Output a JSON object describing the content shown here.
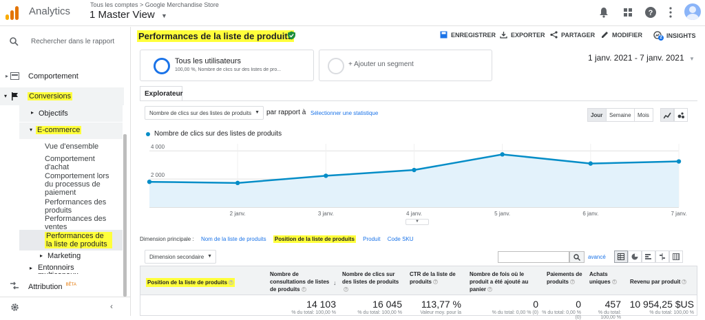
{
  "app": {
    "name": "Analytics",
    "breadcrumb": "Tous les comptes > Google Merchandise Store",
    "view": "1 Master View"
  },
  "sidebar": {
    "search_placeholder": "Rechercher dans le rapport",
    "items": [
      {
        "label": "Comportement"
      },
      {
        "label": "Conversions"
      },
      {
        "label": "Objectifs"
      },
      {
        "label": "E-commerce"
      }
    ],
    "ecommerce_children": [
      "Vue d'ensemble",
      "Comportement d'achat",
      "Comportement lors du processus de paiement",
      "Performances des produits",
      "Performances des ventes",
      "Performances de la liste de produits"
    ],
    "marketing": "Marketing",
    "funnels": "Entonnoirs multicanaux",
    "attribution": "Attribution",
    "attribution_badge": "BÊTA"
  },
  "report": {
    "title": "Performances de la liste de produits",
    "actions": [
      "ENREGISTRER",
      "EXPORTER",
      "PARTAGER",
      "MODIFIER",
      "INSIGHTS"
    ],
    "insights_badge": "2",
    "segment_all": "Tous les utilisateurs",
    "segment_all_sub": "100,00 %, Nombre de clics sur des listes de pro...",
    "segment_add": "+ Ajouter un segment",
    "date_range": "1 janv. 2021 - 7 janv. 2021",
    "tab": "Explorateur",
    "metric_dropdown": "Nombre de clics sur des listes de produits",
    "compare_label": "par rapport à",
    "compare_link": "Sélectionner une statistique",
    "granularity": [
      "Jour",
      "Semaine",
      "Mois"
    ],
    "legend": "Nombre de clics sur des listes de produits",
    "primary_dim_label": "Dimension principale :",
    "primary_dims": [
      "Nom de la liste de produits",
      "Position de la liste de produits",
      "Produit",
      "Code SKU"
    ],
    "secondary_dim": "Dimension secondaire",
    "advanced": "avancé"
  },
  "chart_data": {
    "type": "line",
    "x": [
      "1 janv.",
      "2 janv.",
      "3 janv.",
      "4 janv.",
      "5 janv.",
      "6 janv.",
      "7 janv."
    ],
    "tick_labels": [
      "2 janv.",
      "3 janv.",
      "4 janv.",
      "5 janv.",
      "6 janv.",
      "7 janv."
    ],
    "series": [
      {
        "name": "Nombre de clics sur des listes de produits",
        "values": [
          1800,
          1720,
          2230,
          2640,
          3750,
          3100,
          3250
        ]
      }
    ],
    "yticks": [
      "2 000",
      "4 000"
    ],
    "ylim": [
      0,
      4500
    ],
    "color": "#058dc7",
    "grid": true
  },
  "table": {
    "headers": [
      "Position de la liste de produits",
      "Nombre de consultations de listes de produits",
      "Nombre de clics sur des listes de produits",
      "CTR de la liste de produits",
      "Nombre de fois où le produit a été ajouté au panier",
      "Paiements de produits",
      "Achats uniques",
      "Revenu par produit"
    ],
    "totals": [
      "14 103",
      "16 045",
      "113,77 %",
      "0",
      "0",
      "457",
      "10 954,25 $US"
    ],
    "totals_sub": [
      "% du total: 100,00 %",
      "% du total: 100,00 %",
      "Valeur moy. pour la",
      "% du total: 0,00 % (0)",
      "% du total: 0,00 % (0)",
      "% du total: 100,00 %",
      "% du total: 100,00 %"
    ]
  }
}
